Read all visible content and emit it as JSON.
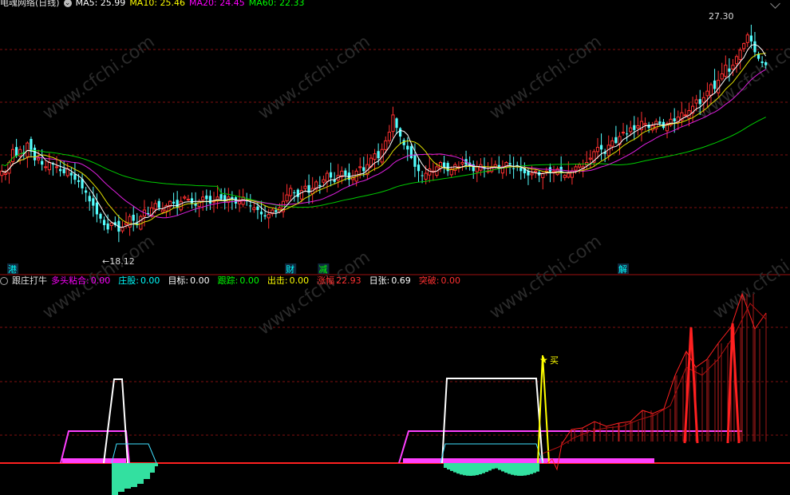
{
  "header": {
    "title": "电魂网络(日线)",
    "ma_items": [
      {
        "label": "MA5: 25.99",
        "color": "#ffffff"
      },
      {
        "label": "MA10: 25.46",
        "color": "#ffff00"
      },
      {
        "label": "MA20: 24.45",
        "color": "#ff00ff"
      },
      {
        "label": "MA60: 22.33",
        "color": "#00ff00"
      }
    ]
  },
  "indicator_header": {
    "name": "跟庄打牛",
    "items": [
      {
        "label": "多头粘合:",
        "value": "0.00",
        "color": "#ff00ff"
      },
      {
        "label": "庄股:",
        "value": "0.00",
        "color": "#00ffff"
      },
      {
        "label": "目标:",
        "value": "0.00",
        "color": "#ffffff"
      },
      {
        "label": "跟踪:",
        "value": "0.00",
        "color": "#00ff00"
      },
      {
        "label": "出击:",
        "value": "0.00",
        "color": "#ffff00"
      },
      {
        "label": "涨幅",
        "value": "22.93",
        "color": "#ff3030"
      },
      {
        "label": "日张:",
        "value": "0.69",
        "color": "#ffffff"
      },
      {
        "label": "突破:",
        "value": "0.00",
        "color": "#ff3030"
      }
    ]
  },
  "chart_data": [
    {
      "type": "candlestick",
      "price_range": [
        16.8,
        28.4
      ],
      "high_annotation": "27.30",
      "low_annotation": "←18.12",
      "event_markers": [
        {
          "label": "港",
          "color": "#00ffff",
          "bar": 3
        },
        {
          "label": "财",
          "color": "#00ffff",
          "bar": 79
        },
        {
          "label": "减",
          "color": "#00ff00",
          "bar": 88
        },
        {
          "label": "解",
          "color": "#00ffff",
          "bar": 170
        }
      ],
      "closes": [
        21.0,
        20.9,
        21.4,
        22.0,
        21.7,
        22.0,
        21.8,
        22.3,
        21.9,
        21.5,
        21.6,
        21.3,
        21.2,
        21.4,
        21.3,
        21.2,
        21.0,
        20.9,
        21.1,
        20.8,
        20.6,
        20.5,
        20.2,
        20.0,
        19.6,
        19.4,
        19.0,
        18.8,
        18.5,
        18.3,
        18.6,
        18.5,
        18.2,
        18.4,
        18.6,
        18.9,
        18.7,
        18.5,
        18.9,
        19.2,
        19.0,
        19.3,
        19.5,
        19.3,
        19.2,
        19.4,
        19.6,
        19.5,
        19.3,
        19.6,
        19.8,
        19.7,
        19.5,
        19.4,
        19.6,
        19.8,
        19.7,
        19.5,
        19.6,
        19.8,
        19.7,
        19.6,
        19.8,
        19.7,
        19.5,
        19.6,
        19.8,
        19.6,
        19.4,
        19.3,
        19.2,
        19.0,
        18.9,
        19.0,
        19.2,
        19.1,
        19.3,
        19.6,
        19.9,
        20.2,
        20.0,
        19.8,
        20.1,
        20.3,
        20.0,
        20.2,
        20.5,
        20.3,
        20.6,
        20.9,
        20.7,
        20.5,
        20.8,
        21.0,
        20.8,
        20.6,
        20.7,
        21.0,
        21.2,
        21.0,
        21.3,
        21.6,
        21.8,
        21.6,
        22.0,
        22.4,
        22.8,
        23.6,
        23.0,
        22.6,
        22.2,
        22.0,
        21.6,
        21.2,
        21.0,
        20.8,
        20.9,
        21.1,
        21.0,
        21.2,
        21.4,
        21.2,
        21.0,
        21.1,
        21.3,
        21.2,
        21.4,
        21.3,
        21.2,
        21.0,
        21.2,
        21.3,
        21.1,
        21.0,
        21.2,
        21.3,
        21.1,
        21.2,
        21.4,
        21.3,
        21.1,
        21.2,
        21.0,
        20.9,
        20.8,
        20.9,
        21.0,
        20.8,
        20.9,
        21.0,
        20.9,
        21.0,
        21.1,
        20.9,
        20.8,
        20.9,
        21.0,
        21.2,
        21.3,
        21.2,
        21.4,
        21.6,
        21.9,
        22.1,
        22.0,
        21.8,
        22.2,
        22.4,
        22.3,
        22.6,
        22.8,
        22.7,
        23.0,
        22.9,
        23.1,
        23.3,
        23.2,
        23.0,
        23.1,
        23.3,
        23.2,
        23.0,
        23.2,
        23.4,
        23.3,
        23.5,
        23.7,
        23.6,
        23.8,
        24.0,
        24.3,
        24.1,
        24.4,
        24.7,
        25.0,
        24.8,
        25.2,
        25.5,
        25.9,
        25.6,
        25.9,
        26.3,
        26.6,
        26.9,
        27.3,
        27.0,
        26.5,
        26.2,
        26.0,
        25.9
      ]
    },
    {
      "type": "indicator",
      "name": "跟庄打牛",
      "buy_signal": "买"
    }
  ]
}
